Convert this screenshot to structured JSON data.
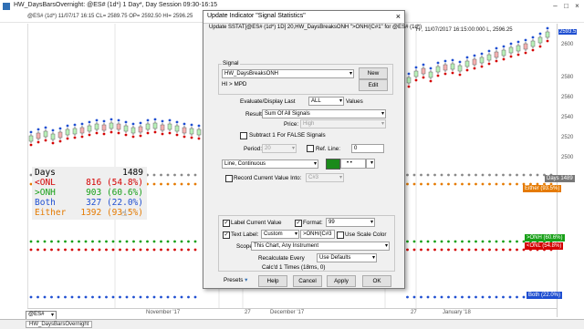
{
  "chart": {
    "window_title": "HW_DaysBarsOvernight: @ES# (1d*) 1 Day*, Day Session 09:30-16:15",
    "subbar": "@ES# (1d*) 11/07/17 16:15 CL= 2589.75 OP= 2592.50 HI= 2596.25",
    "right_info": "H , 11/07/2017 16:15:00:000 L, 2596.25",
    "price_ticks": [
      "2593.5",
      "2600",
      "2580",
      "2560",
      "2540",
      "2520",
      "2500"
    ],
    "x_ticks": [
      "November '17",
      "27",
      "December '17",
      "27",
      "January '18"
    ],
    "tab_label": "HW_DaysBarsOvernight",
    "symbol": "@ES#",
    "accent_blue": "#1f4fd1",
    "accent_red": "#d40000",
    "accent_green": "#18a018",
    "accent_orange": "#e57a00"
  },
  "stats": {
    "rows": [
      {
        "label": "Days",
        "value": "1489",
        "color": "#555555"
      },
      {
        "label": "<ONL",
        "value": "816 (54.8%)",
        "color": "#d40000"
      },
      {
        "label": ">ONH",
        "value": "903 (60.6%)",
        "color": "#18a018"
      },
      {
        "label": "Both",
        "value": "327 (22.0%)",
        "color": "#1f4fd1"
      },
      {
        "label": "Either",
        "value": "1392 (93.5%)",
        "color": "#e57a00"
      }
    ]
  },
  "right_labels": {
    "days": "Days 1489",
    "either": "Either (93.5%)",
    "onh": ">ONH (60.6%)",
    "onl": "<ONL (54.8%)",
    "both": "Both (22.0%)"
  },
  "dialog": {
    "title": "Update Indicator \"Signal Statistics\"",
    "subtitle": "Update SSTAT[@ES# (1d*) 1D] 20,HW_DaysBreaksONH \">ONH/(C#1\" for @ES# (1d*)",
    "signal_group": "Signal",
    "signal_value": "HW_DaysBreaksONH",
    "signal_expr": "HI > MPD",
    "new_label": "New",
    "edit_label": "Edit",
    "evaluate_label": "Evaluate/Display Last",
    "evaluate_value": "ALL",
    "values_label": "Values",
    "result_label": "Result:",
    "result_value": "Sum Of All Signals",
    "price_label": "Price:",
    "price_value": "High",
    "subtract_label": "Subtract 1 For FALSE Signals",
    "period_label": "Period:",
    "period_value": "20",
    "refline_label": "Ref. Line:",
    "refline_value": "0",
    "line_style_value": "Line, Continuous",
    "record_label": "Record Current Value Into:",
    "record_value": "C#3",
    "label_current_label": "Label Current Value",
    "format_label": "Format:",
    "format_value": "99",
    "text_label_label": "Text Label:",
    "text_label_mode": "Custom",
    "text_label_value": ">ONH/(C#3",
    "scale_color_label": "Use Scale Color",
    "scope_label": "Scope:",
    "scope_value": "This Chart, Any Instrument",
    "recalc_label": "Recalculate Every",
    "recalc_value": "Use Defaults",
    "calc_info": "Calc'd 1 Times (18ms, 0)",
    "presets_label": "Presets",
    "help_label": "Help",
    "cancel_label": "Cancel",
    "apply_label": "Apply",
    "ok_label": "OK",
    "plot_color": "#1a8a1a"
  }
}
